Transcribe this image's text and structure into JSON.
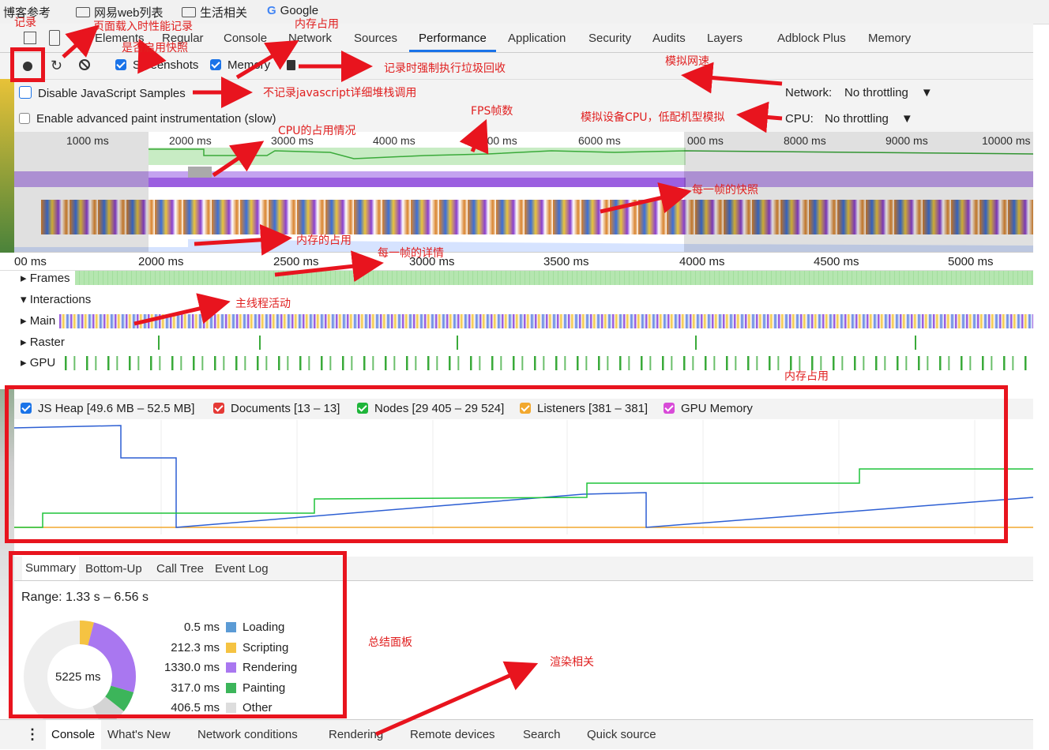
{
  "bookmarks": [
    {
      "label": "博客参考",
      "icon": "folder-icon"
    },
    {
      "label": "网易web列表",
      "icon": "folder-icon"
    },
    {
      "label": "生活相关",
      "icon": "folder-icon"
    },
    {
      "label": "Google",
      "icon": "google-icon"
    }
  ],
  "tabs": [
    "Elements",
    "Regular",
    "Console",
    "Network",
    "Sources",
    "Performance",
    "Application",
    "Security",
    "Audits",
    "Layers",
    "Adblock Plus",
    "Memory"
  ],
  "active_tab": "Performance",
  "toolbar": {
    "screenshots_label": "Screenshots",
    "screenshots_checked": true,
    "memory_label": "Memory",
    "memory_checked": true
  },
  "settings": {
    "disable_js_samples": "Disable JavaScript Samples",
    "advanced_paint": "Enable advanced paint instrumentation (slow)",
    "network_label": "Network:",
    "network_value": "No throttling",
    "cpu_label": "CPU:",
    "cpu_value": "No throttling"
  },
  "overview_ticks": [
    "1000 ms",
    "2000 ms",
    "3000 ms",
    "4000 ms",
    "5000 ms",
    "6000 ms",
    "000 ms",
    "8000 ms",
    "9000 ms",
    "10000 ms"
  ],
  "ruler_ticks": [
    "00 ms",
    "2000 ms",
    "2500 ms",
    "3000 ms",
    "3500 ms",
    "4000 ms",
    "4500 ms",
    "5000 ms"
  ],
  "tracks": {
    "frames": "Frames",
    "interactions": "Interactions",
    "main": "Main",
    "raster": "Raster",
    "gpu": "GPU"
  },
  "memory_legend": [
    {
      "label": "JS Heap [49.6 MB – 52.5 MB]",
      "color": "#1a73e8"
    },
    {
      "label": "Documents [13 – 13]",
      "color": "#e53935"
    },
    {
      "label": "Nodes [29 405 – 29 524]",
      "color": "#1fb53a"
    },
    {
      "label": "Listeners [381 – 381]",
      "color": "#f2a82e"
    },
    {
      "label": "GPU Memory",
      "color": "#d84bd8"
    }
  ],
  "summary": {
    "tabs": [
      "Summary",
      "Bottom-Up",
      "Call Tree",
      "Event Log"
    ],
    "range": "Range: 1.33 s – 6.56 s",
    "total": "5225 ms",
    "items": [
      {
        "value": "0.5 ms",
        "label": "Loading",
        "color": "#5b9bd5"
      },
      {
        "value": "212.3 ms",
        "label": "Scripting",
        "color": "#f5c342"
      },
      {
        "value": "1330.0 ms",
        "label": "Rendering",
        "color": "#a977f0"
      },
      {
        "value": "317.0 ms",
        "label": "Painting",
        "color": "#3cb55a"
      },
      {
        "value": "406.5 ms",
        "label": "Other",
        "color": "#dddddd"
      }
    ]
  },
  "drawer_tabs": [
    "Console",
    "What's New",
    "Network conditions",
    "Rendering",
    "Remote devices",
    "Search",
    "Quick source"
  ],
  "annotations": {
    "record": "记录",
    "page_load": "页面载入时性能记录",
    "screenshot": "是否启用快照",
    "memory_use": "内存占用",
    "gc": "记录时强制执行垃圾回收",
    "network_sim": "模拟网速",
    "no_js_stack": "不记录javascript详细堆栈调用",
    "fps": "FPS帧数",
    "cpu_sim": "模拟设备CPU，低配机型模拟",
    "cpu_usage": "CPU的占用情况",
    "frame_snapshot": "每一帧的快照",
    "mem_usage": "内存的占用",
    "frame_detail": "每一帧的详情",
    "main_thread": "主线程活动",
    "memory_section": "内存占用",
    "summary_panel": "总结面板",
    "rendering_related": "渲染相关"
  }
}
